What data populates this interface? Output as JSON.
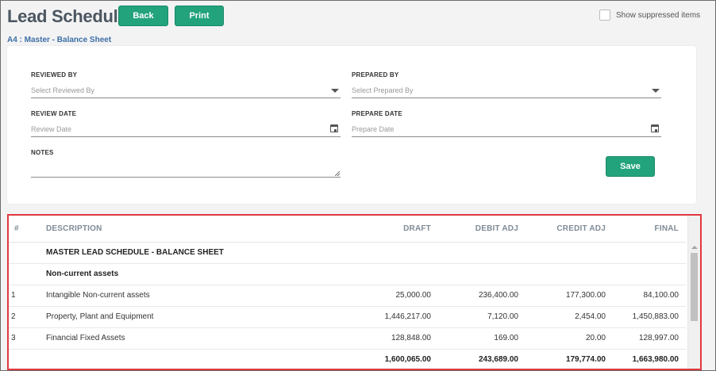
{
  "header": {
    "title": "Lead Schedule",
    "back_label": "Back",
    "print_label": "Print",
    "suppress_label": "Show suppressed items",
    "breadcrumb": "A4 : Master - Balance Sheet"
  },
  "form": {
    "reviewed_by": {
      "label": "REVIEWED BY",
      "placeholder": "Select Reviewed By"
    },
    "prepared_by": {
      "label": "PREPARED BY",
      "placeholder": "Select Prepared By"
    },
    "review_date": {
      "label": "REVIEW DATE",
      "placeholder": "Review Date"
    },
    "prepare_date": {
      "label": "PREPARE DATE",
      "placeholder": "Prepare Date"
    },
    "notes": {
      "label": "NOTES",
      "value": ""
    },
    "save_label": "Save"
  },
  "table": {
    "columns": [
      "#",
      "DESCRIPTION",
      "DRAFT",
      "DEBIT ADJ",
      "CREDIT ADJ",
      "FINAL"
    ],
    "section_title": "MASTER LEAD SCHEDULE - BALANCE SHEET",
    "group_title": "Non-current assets",
    "rows": [
      {
        "num": "1",
        "desc": "Intangible Non-current assets",
        "draft": "25,000.00",
        "debit": "236,400.00",
        "credit": "177,300.00",
        "final": "84,100.00"
      },
      {
        "num": "2",
        "desc": "Property, Plant and Equipment",
        "draft": "1,446,217.00",
        "debit": "7,120.00",
        "credit": "2,454.00",
        "final": "1,450,883.00"
      },
      {
        "num": "3",
        "desc": "Financial Fixed Assets",
        "draft": "128,848.00",
        "debit": "169.00",
        "credit": "20.00",
        "final": "128,997.00"
      }
    ],
    "totals": {
      "draft": "1,600,065.00",
      "debit": "243,689.00",
      "credit": "179,774.00",
      "final": "1,663,980.00"
    }
  },
  "colors": {
    "accent": "#22a37b",
    "highlight_border": "#e0393f",
    "breadcrumb": "#3d6fa5"
  }
}
